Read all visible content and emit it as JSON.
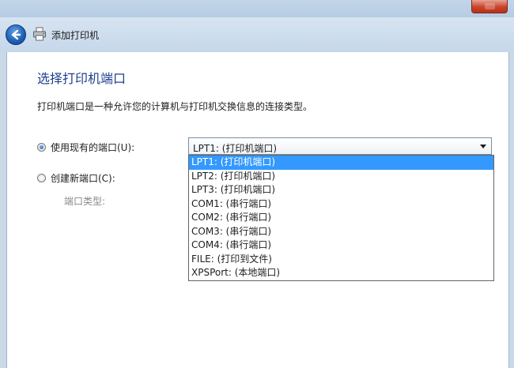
{
  "window": {
    "title": "添加打印机",
    "icons": {
      "back": "back-arrow-icon",
      "printer": "printer-icon",
      "close": "close-icon"
    }
  },
  "page": {
    "heading": "选择打印机端口",
    "description": "打印机端口是一种允许您的计算机与打印机交换信息的连接类型。"
  },
  "options": {
    "existing_port_label": "使用现有的端口(U):",
    "existing_port_selected": true,
    "new_port_label": "创建新端口(C):",
    "new_port_selected": false,
    "port_type_label": "端口类型:"
  },
  "port_combo": {
    "value": "LPT1: (打印机端口)",
    "options": [
      "LPT1: (打印机端口)",
      "LPT2: (打印机端口)",
      "LPT3: (打印机端口)",
      "COM1: (串行端口)",
      "COM2: (串行端口)",
      "COM3: (串行端口)",
      "COM4: (串行端口)",
      "FILE: (打印到文件)",
      "XPSPort: (本地端口)"
    ],
    "highlighted_index": 0
  },
  "colors": {
    "heading": "#1e3f8c",
    "highlight": "#3399ff",
    "disabled_text": "#8a8a8a"
  }
}
